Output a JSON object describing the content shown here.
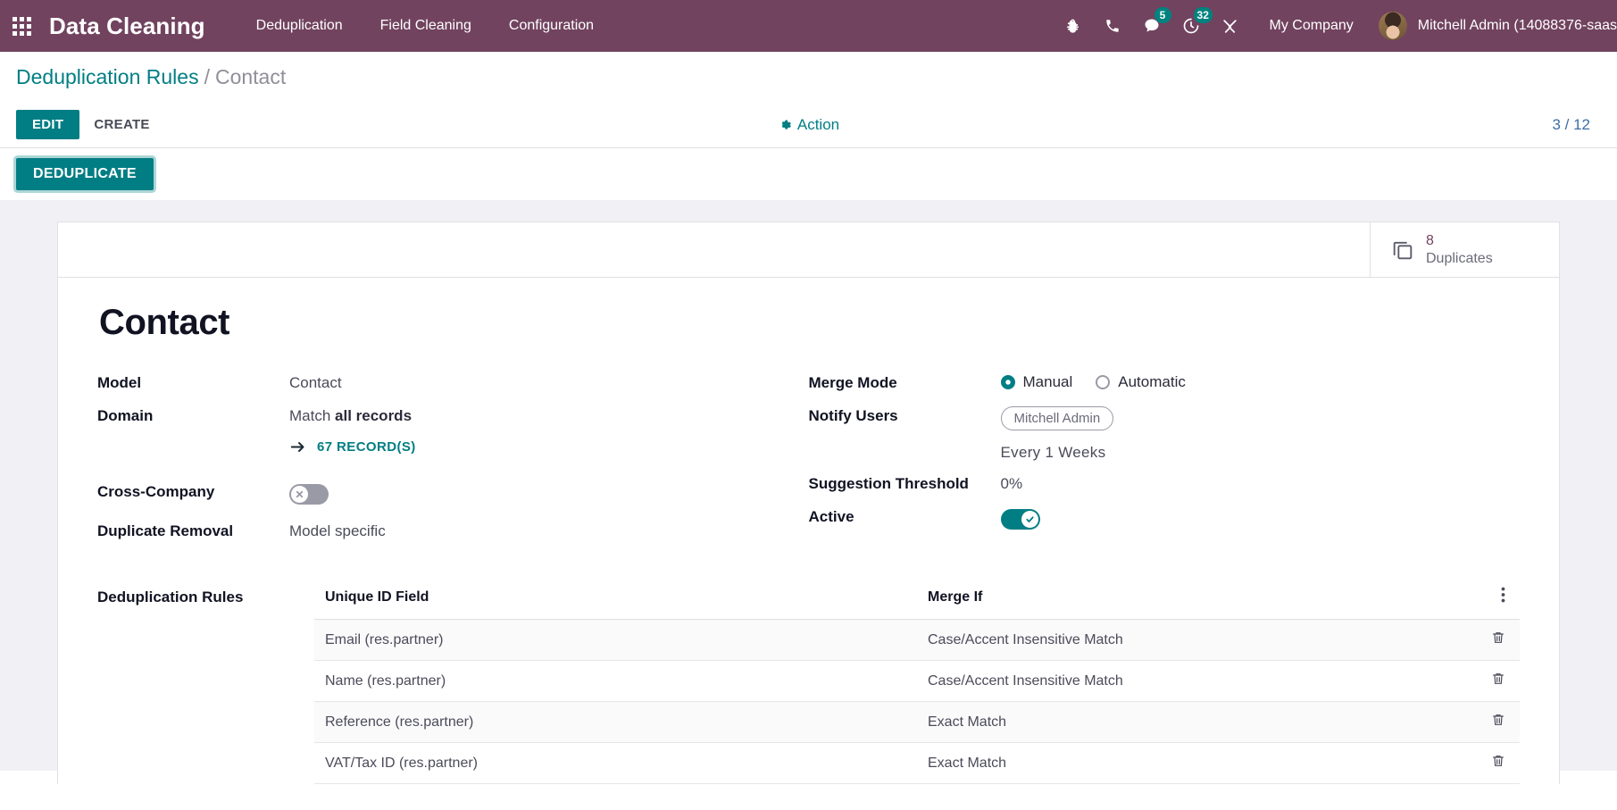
{
  "navbar": {
    "apps_icon": "apps-grid-icon",
    "brand": "Data Cleaning",
    "menu": [
      {
        "label": "Deduplication"
      },
      {
        "label": "Field Cleaning"
      },
      {
        "label": "Configuration"
      }
    ],
    "icons": [
      {
        "name": "bug-icon",
        "badge": null
      },
      {
        "name": "phone-icon",
        "badge": null
      },
      {
        "name": "messages-icon",
        "badge": "5"
      },
      {
        "name": "activities-clock-icon",
        "badge": "32"
      },
      {
        "name": "tools-icon",
        "badge": null
      }
    ],
    "company": "My Company",
    "user": "Mitchell Admin (14088376-saas"
  },
  "breadcrumb": {
    "root": "Deduplication Rules",
    "separator": "/",
    "current": "Contact"
  },
  "control_panel": {
    "edit_label": "EDIT",
    "create_label": "CREATE",
    "action_label": "Action",
    "action_icon": "gear-icon",
    "pager": "3 / 12"
  },
  "subbar": {
    "deduplicate_label": "DEDUPLICATE"
  },
  "smart_button": {
    "icon": "duplicate-copy-icon",
    "value": "8",
    "label": "Duplicates"
  },
  "record": {
    "title": "Contact"
  },
  "left_fields": {
    "model_label": "Model",
    "model_value": "Contact",
    "domain_label": "Domain",
    "domain_prefix": "Match ",
    "domain_value": "all records",
    "records_link": "67 RECORD(S)",
    "records_arrow_icon": "arrow-right-icon",
    "cross_company_label": "Cross-Company",
    "cross_company_state": "off",
    "duplicate_removal_label": "Duplicate Removal",
    "duplicate_removal_value": "Model specific"
  },
  "right_fields": {
    "merge_mode_label": "Merge Mode",
    "merge_mode_options": [
      {
        "label": "Manual",
        "selected": true
      },
      {
        "label": "Automatic",
        "selected": false
      }
    ],
    "notify_users_label": "Notify Users",
    "notify_users_tag": "Mitchell Admin",
    "interval": "Every  1  Weeks",
    "suggestion_threshold_label": "Suggestion Threshold",
    "suggestion_threshold_value": "0%",
    "active_label": "Active",
    "active_state": "on"
  },
  "rules_table": {
    "section_label": "Deduplication Rules",
    "columns": [
      "Unique ID Field",
      "Merge If"
    ],
    "options_icon": "vertical-dots-icon",
    "delete_icon": "trash-icon",
    "rows": [
      {
        "field": "Email (res.partner)",
        "merge_if": "Case/Accent Insensitive Match"
      },
      {
        "field": "Name (res.partner)",
        "merge_if": "Case/Accent Insensitive Match"
      },
      {
        "field": "Reference (res.partner)",
        "merge_if": "Exact Match"
      },
      {
        "field": "VAT/Tax ID (res.partner)",
        "merge_if": "Exact Match"
      }
    ]
  },
  "colors": {
    "navbar": "#71435f",
    "accent": "#017e84",
    "badge": "#00837f",
    "link": "#3c6ea4"
  }
}
